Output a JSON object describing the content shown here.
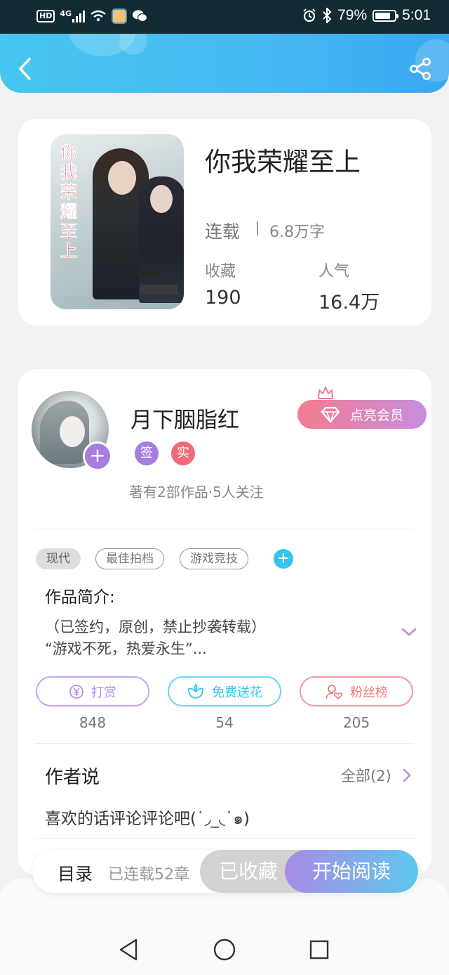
{
  "status_bar": {
    "hd": "HD",
    "network": "4G",
    "battery": "79%",
    "battery_level": 0.79,
    "time": "5:01"
  },
  "header": {
    "back_icon": "back-chevron-icon",
    "share_icon": "share-icon"
  },
  "book": {
    "cover_title": "你我荣耀至上",
    "title": "你我荣耀至上",
    "status": "连载",
    "word_count": "6.8万字",
    "favorites_label": "收藏",
    "favorites_value": "190",
    "popularity_label": "人气",
    "popularity_value": "16.4万"
  },
  "author": {
    "name": "月下胭脂红",
    "badge_signed": "签",
    "badge_verified": "实",
    "meta": "著有2部作品·5人关注",
    "vip_button": "点亮会员",
    "colors": {
      "signed": "#a77de0",
      "verified": "#f06a7a"
    }
  },
  "tags": [
    "现代",
    "最佳拍档",
    "游戏竞技"
  ],
  "intro": {
    "heading": "作品简介:",
    "line1": "（已签约，原创，禁止抄袭转载）",
    "line2": "“游戏不死，热爱永生”..."
  },
  "actions": [
    {
      "label": "打赏",
      "count": "848",
      "icon": "yen-coin-icon",
      "color": "#b58ee6"
    },
    {
      "label": "免费送花",
      "count": "54",
      "icon": "flower-icon",
      "color": "#35c4ef"
    },
    {
      "label": "粉丝榜",
      "count": "205",
      "icon": "fan-user-icon",
      "color": "#f07a80"
    }
  ],
  "author_says": {
    "heading": "作者说",
    "all_link": "全部(2)",
    "text": "喜欢的话评论评论吧(˙◞_◟˙๑)"
  },
  "bottom_bar": {
    "toc": "目录",
    "chapters": "已连载52章",
    "saved_button": "已收藏",
    "read_button": "开始阅读"
  },
  "nav": {
    "back": "nav-back-icon",
    "home": "nav-home-icon",
    "recents": "nav-recents-icon"
  }
}
